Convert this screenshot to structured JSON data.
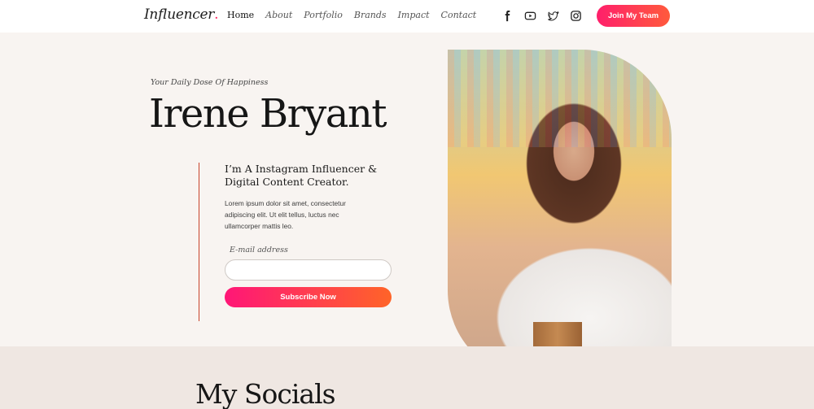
{
  "nav": {
    "logo": "Influencer",
    "logo_dot": ".",
    "menu": [
      "Home",
      "About",
      "Portfolio",
      "Brands",
      "Impact",
      "Contact"
    ],
    "social_icons": [
      "facebook-icon",
      "youtube-icon",
      "twitter-icon",
      "instagram-icon"
    ],
    "cta": "Join My Team"
  },
  "hero": {
    "tagline": "Your Daily Dose Of Happiness",
    "name": "Irene Bryant",
    "role_line1": "I’m A Instagram Influencer &",
    "role_line2": "Digital Content Creator.",
    "description": "Lorem ipsum dolor sit amet, consectetur adipiscing elit. Ut elit tellus, luctus nec ullamcorper mattis leo.",
    "email_label": "E-mail address",
    "email_value": "",
    "email_placeholder": "",
    "subscribe": "Subscribe Now"
  },
  "socials_section": {
    "title": "My Socials"
  },
  "colors": {
    "accent_start": "#ff1f6b",
    "accent_end": "#ff5a3c",
    "background": "#f8f4f1",
    "section_bg": "#efe7e2",
    "divider": "#c8422a"
  }
}
